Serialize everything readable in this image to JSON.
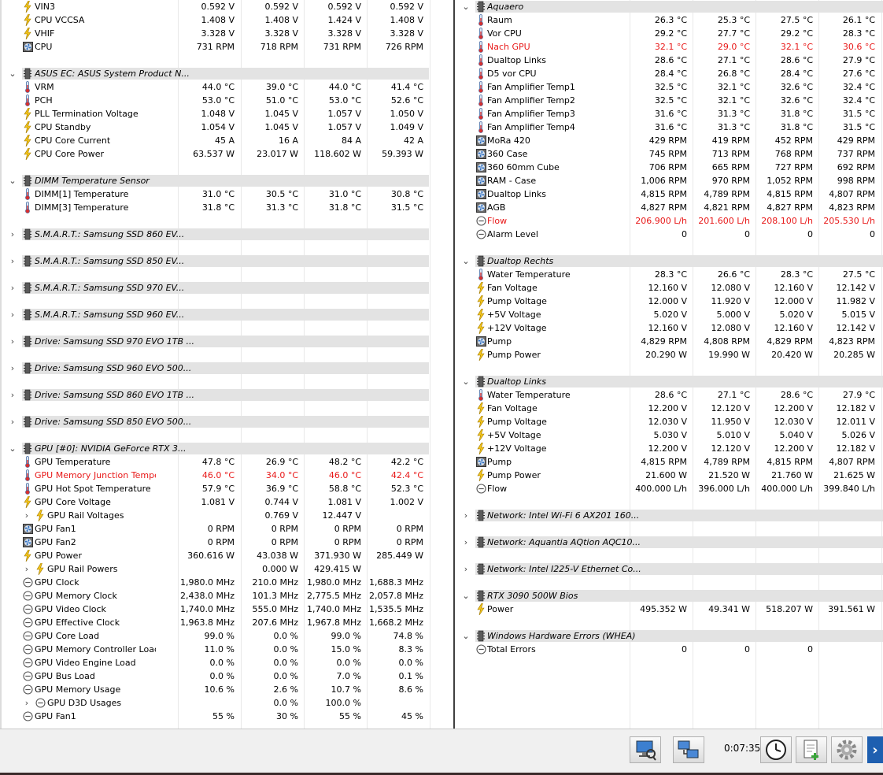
{
  "colors": {
    "critical": "#e81818",
    "group_bg": "#e3e3e3"
  },
  "left": [
    {
      "t": "s",
      "icon": "bolt",
      "label": "VIN3",
      "v": [
        "0.592 V",
        "0.592 V",
        "0.592 V",
        "0.592 V"
      ]
    },
    {
      "t": "s",
      "icon": "bolt",
      "label": "CPU VCCSA",
      "v": [
        "1.408 V",
        "1.408 V",
        "1.424 V",
        "1.408 V"
      ]
    },
    {
      "t": "s",
      "icon": "bolt",
      "label": "VHIF",
      "v": [
        "3.328 V",
        "3.328 V",
        "3.328 V",
        "3.328 V"
      ]
    },
    {
      "t": "s",
      "icon": "fan",
      "label": "CPU",
      "v": [
        "731 RPM",
        "718 RPM",
        "731 RPM",
        "726 RPM"
      ]
    },
    {
      "t": "b"
    },
    {
      "t": "g",
      "open": true,
      "label": "ASUS EC: ASUS System Product N..."
    },
    {
      "t": "s",
      "icon": "therm",
      "label": "VRM",
      "v": [
        "44.0 °C",
        "39.0 °C",
        "44.0 °C",
        "41.4 °C"
      ]
    },
    {
      "t": "s",
      "icon": "therm",
      "label": "PCH",
      "v": [
        "53.0 °C",
        "51.0 °C",
        "53.0 °C",
        "52.6 °C"
      ]
    },
    {
      "t": "s",
      "icon": "bolt",
      "label": "PLL Termination Voltage",
      "v": [
        "1.048 V",
        "1.045 V",
        "1.057 V",
        "1.050 V"
      ]
    },
    {
      "t": "s",
      "icon": "bolt",
      "label": "CPU Standby",
      "v": [
        "1.054 V",
        "1.045 V",
        "1.057 V",
        "1.049 V"
      ]
    },
    {
      "t": "s",
      "icon": "bolt",
      "label": "CPU Core Current",
      "v": [
        "45 A",
        "16 A",
        "84 A",
        "42 A"
      ]
    },
    {
      "t": "s",
      "icon": "bolt",
      "label": "CPU Core Power",
      "v": [
        "63.537 W",
        "23.017 W",
        "118.602 W",
        "59.393 W"
      ]
    },
    {
      "t": "b"
    },
    {
      "t": "g",
      "open": true,
      "label": "DIMM Temperature Sensor"
    },
    {
      "t": "s",
      "icon": "therm",
      "label": "DIMM[1] Temperature",
      "v": [
        "31.0 °C",
        "30.5 °C",
        "31.0 °C",
        "30.8 °C"
      ]
    },
    {
      "t": "s",
      "icon": "therm",
      "label": "DIMM[3] Temperature",
      "v": [
        "31.8 °C",
        "31.3 °C",
        "31.8 °C",
        "31.5 °C"
      ]
    },
    {
      "t": "b"
    },
    {
      "t": "g",
      "open": false,
      "label": "S.M.A.R.T.: Samsung SSD 860 EV..."
    },
    {
      "t": "b"
    },
    {
      "t": "g",
      "open": false,
      "label": "S.M.A.R.T.: Samsung SSD 850 EV..."
    },
    {
      "t": "b"
    },
    {
      "t": "g",
      "open": false,
      "label": "S.M.A.R.T.: Samsung SSD 970 EV..."
    },
    {
      "t": "b"
    },
    {
      "t": "g",
      "open": false,
      "label": "S.M.A.R.T.: Samsung SSD 960 EV..."
    },
    {
      "t": "b"
    },
    {
      "t": "g",
      "open": false,
      "label": "Drive: Samsung SSD 970 EVO 1TB ..."
    },
    {
      "t": "b"
    },
    {
      "t": "g",
      "open": false,
      "label": "Drive: Samsung SSD 960 EVO 500..."
    },
    {
      "t": "b"
    },
    {
      "t": "g",
      "open": false,
      "label": "Drive: Samsung SSD 860 EVO 1TB ..."
    },
    {
      "t": "b"
    },
    {
      "t": "g",
      "open": false,
      "label": "Drive: Samsung SSD 850 EVO 500..."
    },
    {
      "t": "b"
    },
    {
      "t": "g",
      "open": true,
      "label": "GPU [#0]: NVIDIA GeForce RTX 3..."
    },
    {
      "t": "s",
      "icon": "therm",
      "label": "GPU Temperature",
      "v": [
        "47.8 °C",
        "26.9 °C",
        "48.2 °C",
        "42.2 °C"
      ]
    },
    {
      "t": "s",
      "icon": "therm",
      "label": "GPU Memory Junction Temperature",
      "red": true,
      "v": [
        "46.0 °C",
        "34.0 °C",
        "46.0 °C",
        "42.4 °C"
      ]
    },
    {
      "t": "s",
      "icon": "therm",
      "label": "GPU Hot Spot Temperature",
      "v": [
        "57.9 °C",
        "36.9 °C",
        "58.8 °C",
        "52.3 °C"
      ]
    },
    {
      "t": "s",
      "icon": "bolt",
      "label": "GPU Core Voltage",
      "v": [
        "1.081 V",
        "0.744 V",
        "1.081 V",
        "1.002 V"
      ]
    },
    {
      "t": "s",
      "icon": "bolt",
      "label": "GPU Rail Voltages",
      "sub": true,
      "v": [
        "",
        "0.769 V",
        "12.447 V",
        ""
      ]
    },
    {
      "t": "s",
      "icon": "fan",
      "label": "GPU Fan1",
      "v": [
        "0 RPM",
        "0 RPM",
        "0 RPM",
        "0 RPM"
      ]
    },
    {
      "t": "s",
      "icon": "fan",
      "label": "GPU Fan2",
      "v": [
        "0 RPM",
        "0 RPM",
        "0 RPM",
        "0 RPM"
      ]
    },
    {
      "t": "s",
      "icon": "bolt",
      "label": "GPU Power",
      "v": [
        "360.616 W",
        "43.038 W",
        "371.930 W",
        "285.449 W"
      ]
    },
    {
      "t": "s",
      "icon": "bolt",
      "label": "GPU Rail Powers",
      "sub": true,
      "v": [
        "",
        "0.000 W",
        "429.415 W",
        ""
      ]
    },
    {
      "t": "s",
      "icon": "clock",
      "label": "GPU Clock",
      "v": [
        "1,980.0 MHz",
        "210.0 MHz",
        "1,980.0 MHz",
        "1,688.3 MHz"
      ]
    },
    {
      "t": "s",
      "icon": "clock",
      "label": "GPU Memory Clock",
      "v": [
        "2,438.0 MHz",
        "101.3 MHz",
        "2,775.5 MHz",
        "2,057.8 MHz"
      ]
    },
    {
      "t": "s",
      "icon": "clock",
      "label": "GPU Video Clock",
      "v": [
        "1,740.0 MHz",
        "555.0 MHz",
        "1,740.0 MHz",
        "1,535.5 MHz"
      ]
    },
    {
      "t": "s",
      "icon": "clock",
      "label": "GPU Effective Clock",
      "v": [
        "1,963.8 MHz",
        "207.6 MHz",
        "1,967.8 MHz",
        "1,668.2 MHz"
      ]
    },
    {
      "t": "s",
      "icon": "clock",
      "label": "GPU Core Load",
      "v": [
        "99.0 %",
        "0.0 %",
        "99.0 %",
        "74.8 %"
      ]
    },
    {
      "t": "s",
      "icon": "clock",
      "label": "GPU Memory Controller Load",
      "v": [
        "11.0 %",
        "0.0 %",
        "15.0 %",
        "8.3 %"
      ]
    },
    {
      "t": "s",
      "icon": "clock",
      "label": "GPU Video Engine Load",
      "v": [
        "0.0 %",
        "0.0 %",
        "0.0 %",
        "0.0 %"
      ]
    },
    {
      "t": "s",
      "icon": "clock",
      "label": "GPU Bus Load",
      "v": [
        "0.0 %",
        "0.0 %",
        "7.0 %",
        "0.1 %"
      ]
    },
    {
      "t": "s",
      "icon": "clock",
      "label": "GPU Memory Usage",
      "v": [
        "10.6 %",
        "2.6 %",
        "10.7 %",
        "8.6 %"
      ]
    },
    {
      "t": "s",
      "icon": "clock",
      "label": "GPU D3D Usages",
      "sub": true,
      "v": [
        "",
        "0.0 %",
        "100.0 %",
        ""
      ]
    },
    {
      "t": "s",
      "icon": "clock",
      "label": "GPU Fan1",
      "v": [
        "55 %",
        "30 %",
        "55 %",
        "45 %"
      ]
    }
  ],
  "right": [
    {
      "t": "g",
      "open": true,
      "label": "Aquaero"
    },
    {
      "t": "s",
      "icon": "therm",
      "label": "Raum",
      "v": [
        "26.3 °C",
        "25.3 °C",
        "27.5 °C",
        "26.1 °C"
      ]
    },
    {
      "t": "s",
      "icon": "therm",
      "label": "Vor CPU",
      "v": [
        "29.2 °C",
        "27.7 °C",
        "29.2 °C",
        "28.3 °C"
      ]
    },
    {
      "t": "s",
      "icon": "therm",
      "label": "Nach GPU",
      "red": true,
      "v": [
        "32.1 °C",
        "29.0 °C",
        "32.1 °C",
        "30.6 °C"
      ]
    },
    {
      "t": "s",
      "icon": "therm",
      "label": "Dualtop Links",
      "v": [
        "28.6 °C",
        "27.1 °C",
        "28.6 °C",
        "27.9 °C"
      ]
    },
    {
      "t": "s",
      "icon": "therm",
      "label": "D5 vor CPU",
      "v": [
        "28.4 °C",
        "26.8 °C",
        "28.4 °C",
        "27.6 °C"
      ]
    },
    {
      "t": "s",
      "icon": "therm",
      "label": "Fan Amplifier Temp1",
      "v": [
        "32.5 °C",
        "32.1 °C",
        "32.6 °C",
        "32.4 °C"
      ]
    },
    {
      "t": "s",
      "icon": "therm",
      "label": "Fan Amplifier Temp2",
      "v": [
        "32.5 °C",
        "32.1 °C",
        "32.6 °C",
        "32.4 °C"
      ]
    },
    {
      "t": "s",
      "icon": "therm",
      "label": "Fan Amplifier Temp3",
      "v": [
        "31.6 °C",
        "31.3 °C",
        "31.8 °C",
        "31.5 °C"
      ]
    },
    {
      "t": "s",
      "icon": "therm",
      "label": "Fan Amplifier Temp4",
      "v": [
        "31.6 °C",
        "31.3 °C",
        "31.8 °C",
        "31.5 °C"
      ]
    },
    {
      "t": "s",
      "icon": "fan",
      "label": "MoRa 420",
      "v": [
        "429 RPM",
        "419 RPM",
        "452 RPM",
        "429 RPM"
      ]
    },
    {
      "t": "s",
      "icon": "fan",
      "label": "360 Case",
      "v": [
        "745 RPM",
        "713 RPM",
        "768 RPM",
        "737 RPM"
      ]
    },
    {
      "t": "s",
      "icon": "fan",
      "label": "360 60mm Cube",
      "v": [
        "706 RPM",
        "665 RPM",
        "727 RPM",
        "692 RPM"
      ]
    },
    {
      "t": "s",
      "icon": "fan",
      "label": "RAM - Case",
      "v": [
        "1,006 RPM",
        "970 RPM",
        "1,052 RPM",
        "998 RPM"
      ]
    },
    {
      "t": "s",
      "icon": "fan",
      "label": "Dualtop Links",
      "v": [
        "4,815 RPM",
        "4,789 RPM",
        "4,815 RPM",
        "4,807 RPM"
      ]
    },
    {
      "t": "s",
      "icon": "fan",
      "label": "AGB",
      "v": [
        "4,827 RPM",
        "4,821 RPM",
        "4,827 RPM",
        "4,823 RPM"
      ]
    },
    {
      "t": "s",
      "icon": "clock",
      "label": "Flow",
      "red": true,
      "v": [
        "206.900 L/h",
        "201.600 L/h",
        "208.100 L/h",
        "205.530 L/h"
      ]
    },
    {
      "t": "s",
      "icon": "clock",
      "label": "Alarm Level",
      "v": [
        "0",
        "0",
        "0",
        "0"
      ]
    },
    {
      "t": "b"
    },
    {
      "t": "g",
      "open": true,
      "label": "Dualtop Rechts"
    },
    {
      "t": "s",
      "icon": "therm",
      "label": "Water Temperature",
      "v": [
        "28.3 °C",
        "26.6 °C",
        "28.3 °C",
        "27.5 °C"
      ]
    },
    {
      "t": "s",
      "icon": "bolt",
      "label": "Fan Voltage",
      "v": [
        "12.160 V",
        "12.080 V",
        "12.160 V",
        "12.142 V"
      ]
    },
    {
      "t": "s",
      "icon": "bolt",
      "label": "Pump Voltage",
      "v": [
        "12.000 V",
        "11.920 V",
        "12.000 V",
        "11.982 V"
      ]
    },
    {
      "t": "s",
      "icon": "bolt",
      "label": "+5V Voltage",
      "v": [
        "5.020 V",
        "5.000 V",
        "5.020 V",
        "5.015 V"
      ]
    },
    {
      "t": "s",
      "icon": "bolt",
      "label": "+12V Voltage",
      "v": [
        "12.160 V",
        "12.080 V",
        "12.160 V",
        "12.142 V"
      ]
    },
    {
      "t": "s",
      "icon": "fan",
      "label": "Pump",
      "v": [
        "4,829 RPM",
        "4,808 RPM",
        "4,829 RPM",
        "4,823 RPM"
      ]
    },
    {
      "t": "s",
      "icon": "bolt",
      "label": "Pump Power",
      "v": [
        "20.290 W",
        "19.990 W",
        "20.420 W",
        "20.285 W"
      ]
    },
    {
      "t": "b"
    },
    {
      "t": "g",
      "open": true,
      "label": "Dualtop Links"
    },
    {
      "t": "s",
      "icon": "therm",
      "label": "Water Temperature",
      "v": [
        "28.6 °C",
        "27.1 °C",
        "28.6 °C",
        "27.9 °C"
      ]
    },
    {
      "t": "s",
      "icon": "bolt",
      "label": "Fan Voltage",
      "v": [
        "12.200 V",
        "12.120 V",
        "12.200 V",
        "12.182 V"
      ]
    },
    {
      "t": "s",
      "icon": "bolt",
      "label": "Pump Voltage",
      "v": [
        "12.030 V",
        "11.950 V",
        "12.030 V",
        "12.011 V"
      ]
    },
    {
      "t": "s",
      "icon": "bolt",
      "label": "+5V Voltage",
      "v": [
        "5.030 V",
        "5.010 V",
        "5.040 V",
        "5.026 V"
      ]
    },
    {
      "t": "s",
      "icon": "bolt",
      "label": "+12V Voltage",
      "v": [
        "12.200 V",
        "12.120 V",
        "12.200 V",
        "12.182 V"
      ]
    },
    {
      "t": "s",
      "icon": "fan",
      "label": "Pump",
      "v": [
        "4,815 RPM",
        "4,789 RPM",
        "4,815 RPM",
        "4,807 RPM"
      ]
    },
    {
      "t": "s",
      "icon": "bolt",
      "label": "Pump Power",
      "v": [
        "21.600 W",
        "21.520 W",
        "21.760 W",
        "21.625 W"
      ]
    },
    {
      "t": "s",
      "icon": "clock",
      "label": "Flow",
      "v": [
        "400.000 L/h",
        "396.000 L/h",
        "400.000 L/h",
        "399.840 L/h"
      ]
    },
    {
      "t": "b"
    },
    {
      "t": "g",
      "open": false,
      "label": "Network: Intel Wi-Fi 6 AX201 160..."
    },
    {
      "t": "b"
    },
    {
      "t": "g",
      "open": false,
      "label": "Network: Aquantia AQtion AQC10..."
    },
    {
      "t": "b"
    },
    {
      "t": "g",
      "open": false,
      "label": "Network: Intel I225-V Ethernet Co..."
    },
    {
      "t": "b"
    },
    {
      "t": "g",
      "open": true,
      "label": "RTX 3090 500W Bios"
    },
    {
      "t": "s",
      "icon": "bolt",
      "label": "Power",
      "v": [
        "495.352 W",
        "49.341 W",
        "518.207 W",
        "391.561 W"
      ]
    },
    {
      "t": "b"
    },
    {
      "t": "g",
      "open": true,
      "label": "Windows Hardware Errors (WHEA)"
    },
    {
      "t": "s",
      "icon": "clock",
      "label": "Total Errors",
      "v": [
        "0",
        "0",
        "0",
        ""
      ]
    }
  ],
  "toolbar": {
    "timer": "0:07:35"
  }
}
